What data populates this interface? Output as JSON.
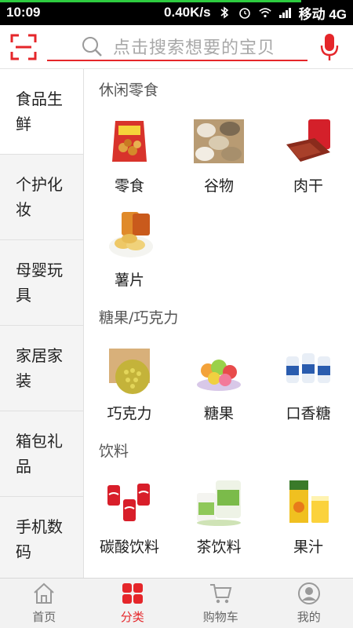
{
  "status_bar": {
    "time": "10:09",
    "speed": "0.40K/s",
    "carrier": "移动 4G"
  },
  "search": {
    "placeholder": "点击搜索想要的宝贝"
  },
  "sidebar": {
    "items": [
      {
        "label": "食品生鲜",
        "active": true
      },
      {
        "label": "个护化妆",
        "active": false
      },
      {
        "label": "母婴玩具",
        "active": false
      },
      {
        "label": "家居家装",
        "active": false
      },
      {
        "label": "箱包礼品",
        "active": false
      },
      {
        "label": "手机数码",
        "active": false
      }
    ]
  },
  "sections": [
    {
      "title": "休闲零食",
      "items": [
        {
          "label": "零食",
          "icon": "snack-bag-icon"
        },
        {
          "label": "谷物",
          "icon": "grain-icon"
        },
        {
          "label": "肉干",
          "icon": "jerky-icon"
        },
        {
          "label": "薯片",
          "icon": "chips-icon"
        }
      ]
    },
    {
      "title": "糖果/巧克力",
      "items": [
        {
          "label": "巧克力",
          "icon": "chocolate-icon"
        },
        {
          "label": "糖果",
          "icon": "candy-icon"
        },
        {
          "label": "口香糖",
          "icon": "gum-icon"
        }
      ]
    },
    {
      "title": "饮料",
      "items": [
        {
          "label": "碳酸饮料",
          "icon": "soda-icon"
        },
        {
          "label": "茶饮料",
          "icon": "tea-icon"
        },
        {
          "label": "果汁",
          "icon": "juice-icon"
        }
      ]
    }
  ],
  "tabbar": {
    "items": [
      {
        "label": "首页",
        "icon": "home-icon",
        "active": false
      },
      {
        "label": "分类",
        "icon": "category-grid-icon",
        "active": true
      },
      {
        "label": "购物车",
        "icon": "cart-icon",
        "active": false
      },
      {
        "label": "我的",
        "icon": "user-icon",
        "active": false
      }
    ]
  },
  "colors": {
    "accent": "#e5262a",
    "sidebar_bg": "#f4f4f4",
    "tabbar_bg": "#f2f2f2"
  }
}
